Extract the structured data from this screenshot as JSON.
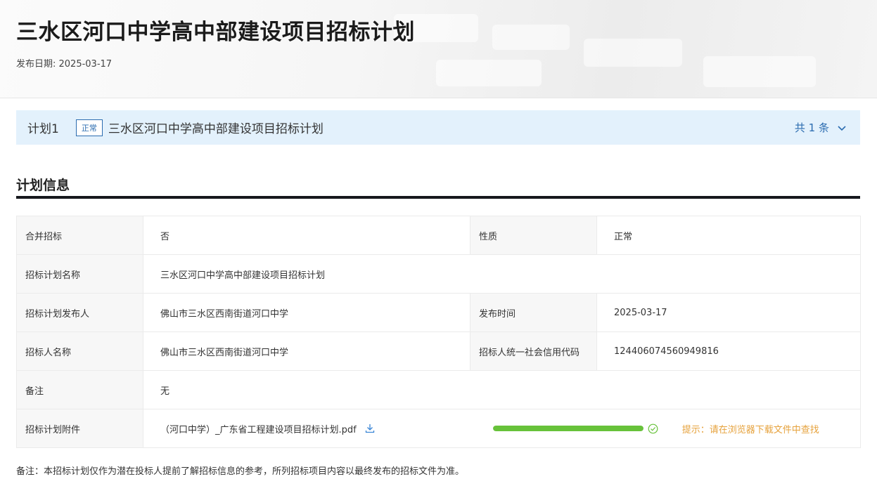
{
  "header": {
    "title": "三水区河口中学高中部建设项目招标计划",
    "publish_date": "发布日期: 2025-03-17"
  },
  "plan_bar": {
    "plan_no": "计划1",
    "status_badge": "正常",
    "plan_name": "三水区河口中学高中部建设项目招标计划",
    "count": "共 1 条"
  },
  "section": {
    "title": "计划信息"
  },
  "info": {
    "merge_label": "合并招标",
    "merge_value": "否",
    "nature_label": "性质",
    "nature_value": "正常",
    "plan_name_label": "招标计划名称",
    "plan_name_value": "三水区河口中学高中部建设项目招标计划",
    "publisher_label": "招标计划发布人",
    "publisher_value": "佛山市三水区西南街道河口中学",
    "publish_time_label": "发布时间",
    "publish_time_value": "2025-03-17",
    "tenderer_label": "招标人名称",
    "tenderer_value": "佛山市三水区西南街道河口中学",
    "credit_code_label": "招标人统一社会信用代码",
    "credit_code_value": "124406074560949816",
    "remark_label": "备注",
    "remark_value": "无",
    "attachment_label": "招标计划附件",
    "attachment_file": "（河口中学）_广东省工程建设项目招标计划.pdf",
    "download_progress": 1.0,
    "download_hint": "提示：请在浏览器下载文件中查找"
  },
  "footer_note": "备注：本招标计划仅作为潜在投标人提前了解招标信息的参考，所列招标项目内容以最终发布的招标文件为准。",
  "colors": {
    "accent": "#2b6cb0",
    "plan_bar_bg": "#e3f1fc",
    "progress": "#67c23a",
    "hint": "#e6a23c"
  },
  "icons": [
    "chevron-down-icon",
    "download-icon",
    "check-circle-icon"
  ]
}
